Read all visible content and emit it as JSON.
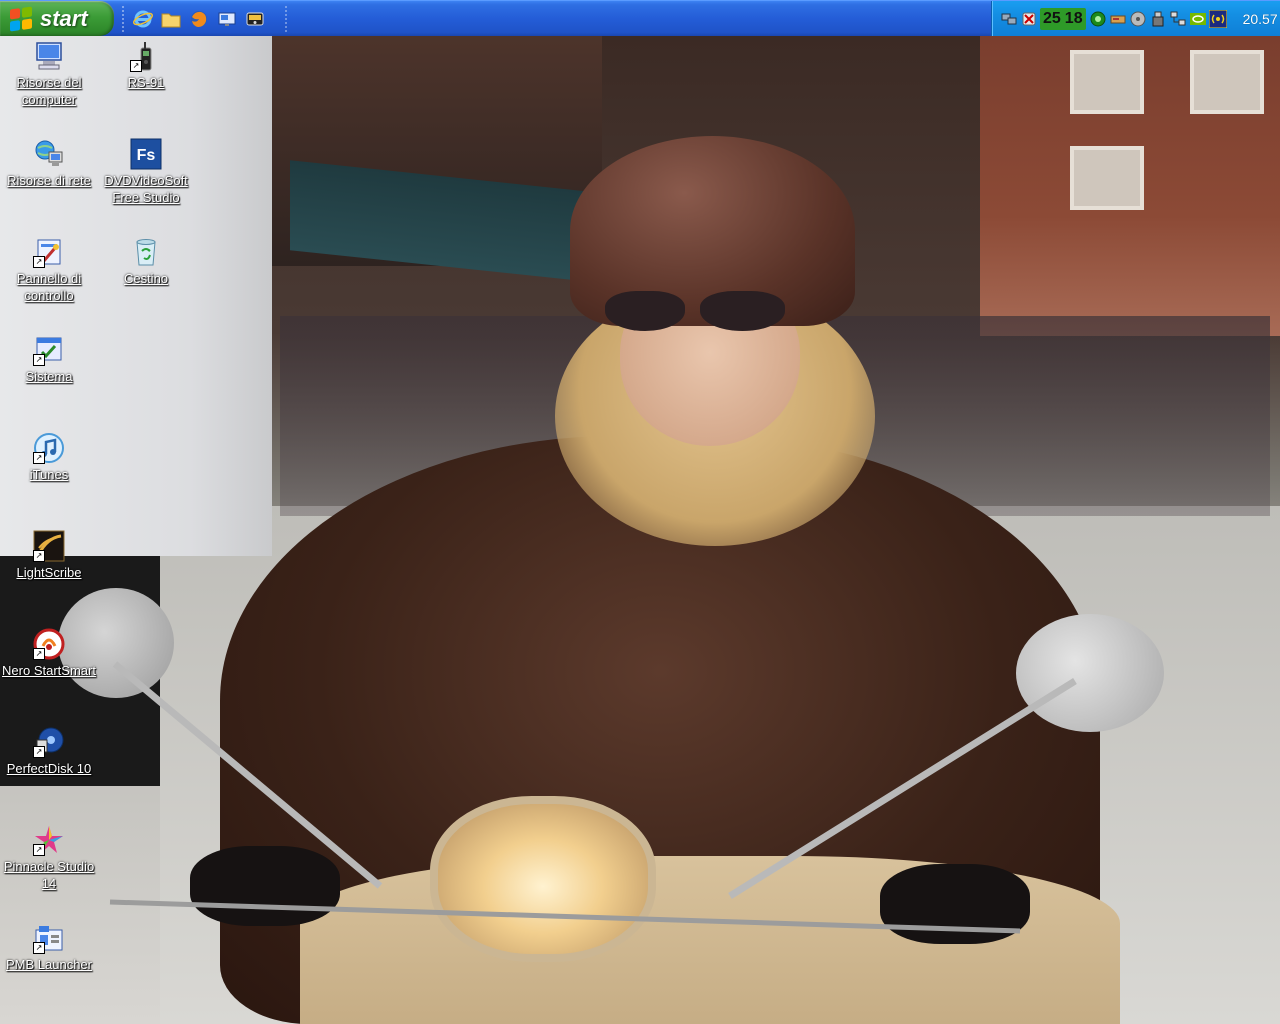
{
  "taskbar": {
    "start_label": "start",
    "quick_launch": [
      {
        "icon": "internet-explorer-icon"
      },
      {
        "icon": "folder-icon"
      },
      {
        "icon": "firefox-icon"
      },
      {
        "icon": "show-desktop-icon"
      },
      {
        "icon": "media-player-icon"
      }
    ],
    "tray": {
      "temp_1": "25",
      "temp_2": "18",
      "clock": "20.57"
    }
  },
  "desktop": {
    "icons": [
      {
        "label": "Risorse del computer",
        "icon": "my-computer-icon"
      },
      {
        "label": "RS-91",
        "icon": "radio-device-icon"
      },
      {
        "label": "Risorse di rete",
        "icon": "network-places-icon"
      },
      {
        "label": "DVDVideoSoft Free Studio",
        "icon": "dvdvideosoft-icon"
      },
      {
        "label": "Pannello di controllo",
        "icon": "control-panel-icon"
      },
      {
        "label": "Cestino",
        "icon": "recycle-bin-icon"
      },
      {
        "label": "Sistema",
        "icon": "system-icon"
      },
      {
        "label": "iTunes",
        "icon": "itunes-icon"
      },
      {
        "label": "LightScribe",
        "icon": "lightscribe-icon"
      },
      {
        "label": "Nero StartSmart",
        "icon": "nero-icon"
      },
      {
        "label": "PerfectDisk 10",
        "icon": "perfectdisk-icon"
      },
      {
        "label": "Pinnacle Studio 14",
        "icon": "pinnacle-studio-icon"
      },
      {
        "label": "PMB Launcher",
        "icon": "pmb-launcher-icon"
      }
    ]
  },
  "colors": {
    "taskbar": "#245dd7",
    "start_button": "#3c9c37",
    "tray": "#148ee3"
  }
}
